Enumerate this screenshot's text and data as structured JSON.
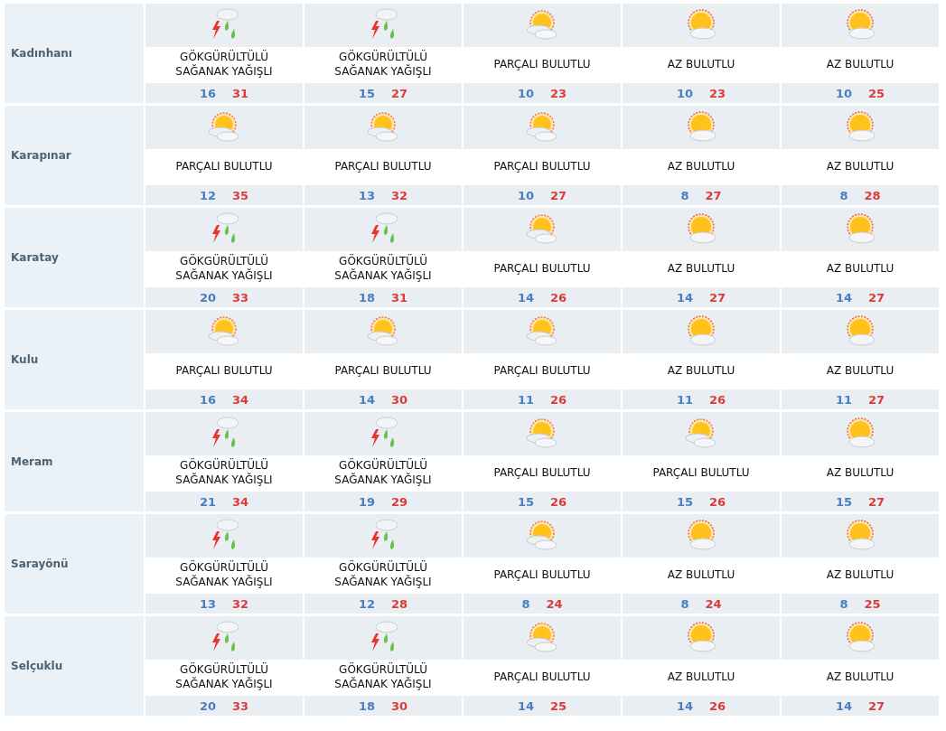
{
  "districts": [
    {
      "name": "Kadınhanı",
      "days": [
        {
          "kind": "storm",
          "condition": "GÖKGÜRÜLTÜLÜ SAĞANAK YAĞIŞLI",
          "low": "16",
          "high": "31"
        },
        {
          "kind": "storm",
          "condition": "GÖKGÜRÜLTÜLÜ SAĞANAK YAĞIŞLI",
          "low": "15",
          "high": "27"
        },
        {
          "kind": "partly",
          "condition": "PARÇALI BULUTLU",
          "low": "10",
          "high": "23"
        },
        {
          "kind": "few",
          "condition": "AZ BULUTLU",
          "low": "10",
          "high": "23"
        },
        {
          "kind": "few",
          "condition": "AZ BULUTLU",
          "low": "10",
          "high": "25"
        }
      ]
    },
    {
      "name": "Karapınar",
      "days": [
        {
          "kind": "partly",
          "condition": "PARÇALI BULUTLU",
          "low": "12",
          "high": "35"
        },
        {
          "kind": "partly",
          "condition": "PARÇALI BULUTLU",
          "low": "13",
          "high": "32"
        },
        {
          "kind": "partly",
          "condition": "PARÇALI BULUTLU",
          "low": "10",
          "high": "27"
        },
        {
          "kind": "few",
          "condition": "AZ BULUTLU",
          "low": "8",
          "high": "27"
        },
        {
          "kind": "few",
          "condition": "AZ BULUTLU",
          "low": "8",
          "high": "28"
        }
      ]
    },
    {
      "name": "Karatay",
      "days": [
        {
          "kind": "storm",
          "condition": "GÖKGÜRÜLTÜLÜ SAĞANAK YAĞIŞLI",
          "low": "20",
          "high": "33"
        },
        {
          "kind": "storm",
          "condition": "GÖKGÜRÜLTÜLÜ SAĞANAK YAĞIŞLI",
          "low": "18",
          "high": "31"
        },
        {
          "kind": "partly",
          "condition": "PARÇALI BULUTLU",
          "low": "14",
          "high": "26"
        },
        {
          "kind": "few",
          "condition": "AZ BULUTLU",
          "low": "14",
          "high": "27"
        },
        {
          "kind": "few",
          "condition": "AZ BULUTLU",
          "low": "14",
          "high": "27"
        }
      ]
    },
    {
      "name": "Kulu",
      "days": [
        {
          "kind": "partly",
          "condition": "PARÇALI BULUTLU",
          "low": "16",
          "high": "34"
        },
        {
          "kind": "partly",
          "condition": "PARÇALI BULUTLU",
          "low": "14",
          "high": "30"
        },
        {
          "kind": "partly",
          "condition": "PARÇALI BULUTLU",
          "low": "11",
          "high": "26"
        },
        {
          "kind": "few",
          "condition": "AZ BULUTLU",
          "low": "11",
          "high": "26"
        },
        {
          "kind": "few",
          "condition": "AZ BULUTLU",
          "low": "11",
          "high": "27"
        }
      ]
    },
    {
      "name": "Meram",
      "days": [
        {
          "kind": "storm",
          "condition": "GÖKGÜRÜLTÜLÜ SAĞANAK YAĞIŞLI",
          "low": "21",
          "high": "34"
        },
        {
          "kind": "storm",
          "condition": "GÖKGÜRÜLTÜLÜ SAĞANAK YAĞIŞLI",
          "low": "19",
          "high": "29"
        },
        {
          "kind": "partly",
          "condition": "PARÇALI BULUTLU",
          "low": "15",
          "high": "26"
        },
        {
          "kind": "partly",
          "condition": "PARÇALI BULUTLU",
          "low": "15",
          "high": "26"
        },
        {
          "kind": "few",
          "condition": "AZ BULUTLU",
          "low": "15",
          "high": "27"
        }
      ]
    },
    {
      "name": "Sarayönü",
      "days": [
        {
          "kind": "storm",
          "condition": "GÖKGÜRÜLTÜLÜ SAĞANAK YAĞIŞLI",
          "low": "13",
          "high": "32"
        },
        {
          "kind": "storm",
          "condition": "GÖKGÜRÜLTÜLÜ SAĞANAK YAĞIŞLI",
          "low": "12",
          "high": "28"
        },
        {
          "kind": "partly",
          "condition": "PARÇALI BULUTLU",
          "low": "8",
          "high": "24"
        },
        {
          "kind": "few",
          "condition": "AZ BULUTLU",
          "low": "8",
          "high": "24"
        },
        {
          "kind": "few",
          "condition": "AZ BULUTLU",
          "low": "8",
          "high": "25"
        }
      ]
    },
    {
      "name": "Selçuklu",
      "days": [
        {
          "kind": "storm",
          "condition": "GÖKGÜRÜLTÜLÜ SAĞANAK YAĞIŞLI",
          "low": "20",
          "high": "33"
        },
        {
          "kind": "storm",
          "condition": "GÖKGÜRÜLTÜLÜ SAĞANAK YAĞIŞLI",
          "low": "18",
          "high": "30"
        },
        {
          "kind": "partly",
          "condition": "PARÇALI BULUTLU",
          "low": "14",
          "high": "25"
        },
        {
          "kind": "few",
          "condition": "AZ BULUTLU",
          "low": "14",
          "high": "26"
        },
        {
          "kind": "few",
          "condition": "AZ BULUTLU",
          "low": "14",
          "high": "27"
        }
      ]
    }
  ]
}
